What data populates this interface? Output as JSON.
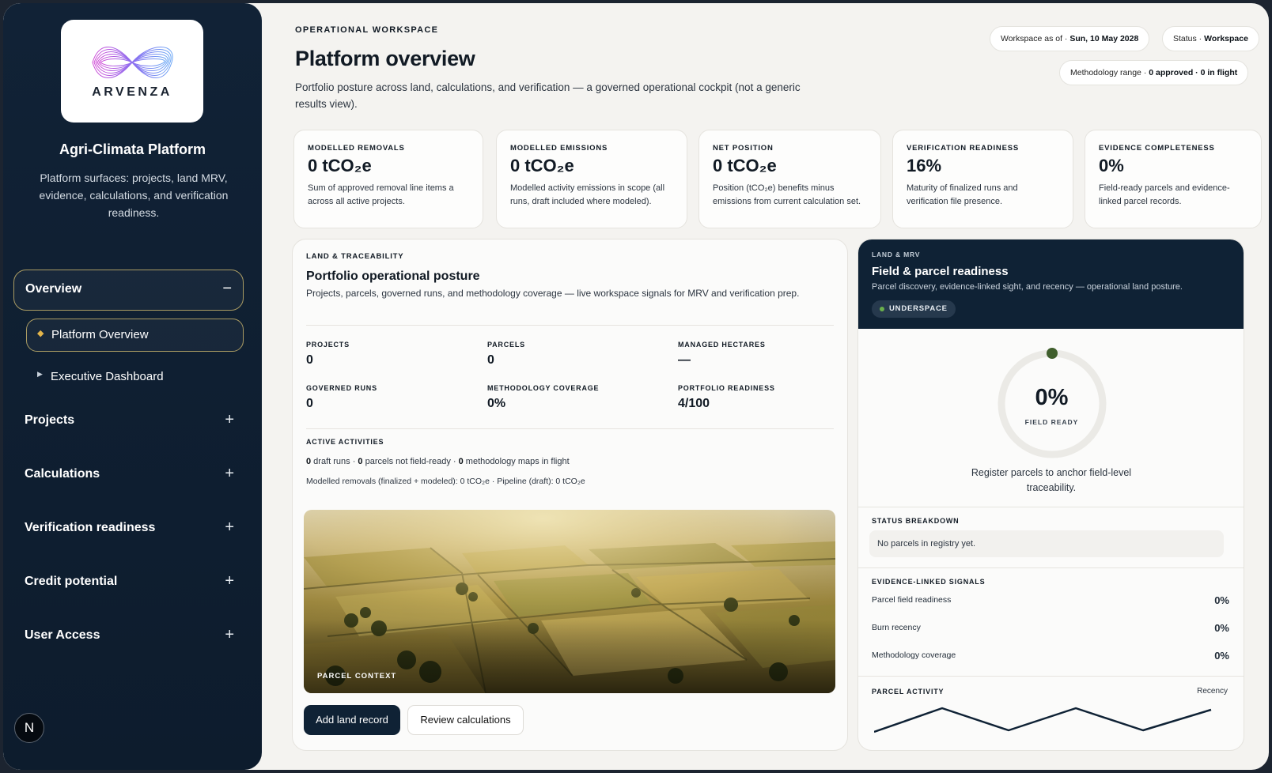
{
  "brand": {
    "logo_text": "ARVENZA",
    "platform_name": "Agri-Climata Platform",
    "platform_desc": "Platform surfaces: projects, land MRV, evidence, calculations, and verification readiness."
  },
  "nav": {
    "overview": {
      "label": "Overview",
      "toggle": "−"
    },
    "sub": [
      {
        "label": "Platform Overview"
      },
      {
        "label": "Executive Dashboard"
      }
    ],
    "items": [
      {
        "label": "Projects",
        "toggle": "+"
      },
      {
        "label": "Calculations",
        "toggle": "+"
      },
      {
        "label": "Verification readiness",
        "toggle": "+"
      },
      {
        "label": "Credit potential",
        "toggle": "+"
      },
      {
        "label": "User Access",
        "toggle": "+"
      }
    ],
    "avatar": "N"
  },
  "header": {
    "eyebrow": "OPERATIONAL WORKSPACE",
    "title": "Platform overview",
    "desc": "Portfolio posture across land, calculations, and verification — a governed operational cockpit (not a generic results view).",
    "pills": {
      "asof_label": "Workspace as of · ",
      "asof_value": "Sun, 10 May 2028",
      "status_label": "Status · ",
      "status_value": "Workspace",
      "method_label": "Methodology range · ",
      "method_value": "0 approved · 0 in flight"
    }
  },
  "kpis": [
    {
      "label": "MODELLED REMOVALS",
      "value": "0 tCO₂e",
      "desc": "Sum of approved removal line items a across all active projects."
    },
    {
      "label": "MODELLED EMISSIONS",
      "value": "0 tCO₂e",
      "desc": "Modelled activity emissions in scope (all runs, draft included where modeled)."
    },
    {
      "label": "NET POSITION",
      "value": "0 tCO₂e",
      "desc": "Position (tCO₂e) benefits minus emissions from current calculation set."
    },
    {
      "label": "VERIFICATION READINESS",
      "value": "16%",
      "desc": "Maturity of finalized runs and verification file presence."
    },
    {
      "label": "EVIDENCE COMPLETENESS",
      "value": "0%",
      "desc": "Field-ready parcels and evidence-linked parcel records."
    }
  ],
  "land": {
    "eyebrow": "LAND & TRACEABILITY",
    "title": "Portfolio operational posture",
    "desc": "Projects, parcels, governed runs, and methodology coverage — live workspace signals for MRV and verification prep.",
    "stats": [
      {
        "label": "PROJECTS",
        "value": "0"
      },
      {
        "label": "PARCELS",
        "value": "0"
      },
      {
        "label": "MANAGED HECTARES",
        "value": "—"
      },
      {
        "label": "GOVERNED RUNS",
        "value": "0"
      },
      {
        "label": "METHODOLOGY COVERAGE",
        "value": "0%"
      },
      {
        "label": "PORTFOLIO READINESS",
        "value": "4/100"
      }
    ],
    "activities": {
      "eyebrow": "ACTIVE ACTIVITIES",
      "n1": "0",
      "t1": " draft runs · ",
      "n2": "0",
      "t2": " parcels not field-ready · ",
      "n3": "0",
      "t3": " methodology maps in flight",
      "line2": "Modelled removals (finalized + modeled): 0 tCO₂e · Pipeline (draft): 0 tCO₂e"
    },
    "photo_label": "PARCEL CONTEXT",
    "btn_add": "Add land record",
    "btn_review": "Review calculations"
  },
  "field": {
    "eyebrow": "LAND & MRV",
    "title": "Field & parcel readiness",
    "desc": "Parcel discovery, evidence-linked sight, and recency — operational land posture.",
    "badge": "UNDERSPACE",
    "ring_value": "0%",
    "ring_fraction": 0,
    "ring_label": "FIELD READY",
    "ring_caption": "Register parcels to anchor field-level traceability.",
    "status_eyebrow": "STATUS BREAKDOWN",
    "status_empty": "No parcels in registry yet.",
    "signals_eyebrow": "EVIDENCE-LINKED SIGNALS",
    "signals": [
      {
        "label": "Parcel field readiness",
        "value": "0%"
      },
      {
        "label": "Burn recency",
        "value": "0%"
      },
      {
        "label": "Methodology coverage",
        "value": "0%"
      }
    ],
    "activity_eyebrow": "PARCEL ACTIVITY",
    "activity_right": "Recency"
  },
  "colors": {
    "navy": "#0f2235",
    "accent_gold": "#a99b63",
    "ring_dot": "#3f5e2c"
  }
}
